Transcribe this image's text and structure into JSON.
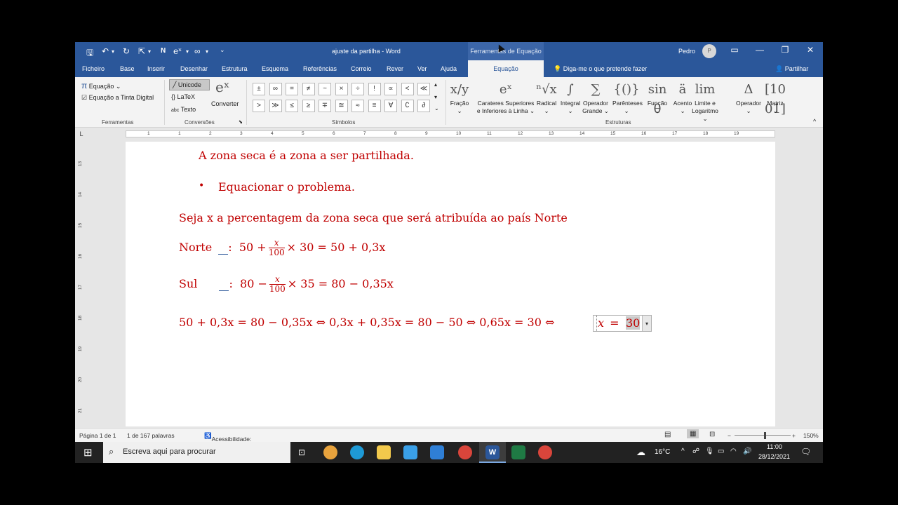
{
  "titlebar": {
    "document_title": "ajuste da partilha  -  Word",
    "context_group": "Ferramentas de Equação",
    "user_name": "Pedro",
    "user_initial": "P",
    "qat": {
      "save": "🖫",
      "undo": "↶",
      "undo_drop": "▾",
      "redo": "↻",
      "pointer": "⇱",
      "pointer_drop": "▾",
      "n": "N",
      "ex": "eˣ",
      "ex_drop": "▾",
      "inf": "∞",
      "inf_drop": "▾",
      "customize": "⌄"
    },
    "controls": {
      "ribbon_display": "▭",
      "minimize": "—",
      "restore": "❐",
      "close": "✕"
    }
  },
  "tabs": [
    "Ficheiro",
    "Base",
    "Inserir",
    "Desenhar",
    "Estrutura",
    "Esquema",
    "Referências",
    "Correio",
    "Rever",
    "Ver",
    "Ajuda"
  ],
  "active_tab": "Equação",
  "tell_me": "Diga-me o que pretende fazer",
  "share": "Partilhar",
  "ribbon": {
    "ferramentas": {
      "equation": "Equação",
      "equation_icon": "π",
      "ink": "Equação a Tinta Digital",
      "label": "Ferramentas"
    },
    "conversoes": {
      "unicode": "Unicode",
      "latex": "LaTeX",
      "text": "Texto",
      "convert": "Converter",
      "label": "Conversões",
      "dialog_launcher": "⬊"
    },
    "simbolos": {
      "row1": [
        "±",
        "∞",
        "=",
        "≠",
        "~",
        "×",
        "÷",
        "!",
        "∝",
        "<",
        "≪"
      ],
      "row2": [
        ">",
        "≫",
        "≤",
        "≥",
        "∓",
        "≅",
        "≈",
        "≡",
        "∀",
        "∁",
        "∂"
      ],
      "label": "Símbolos"
    },
    "estruturas": {
      "items": [
        {
          "icon": "x/y",
          "label1": "Fração",
          "label2": "⌄"
        },
        {
          "icon": "eˣ",
          "label1": "Carateres Superiores",
          "label2": "e Inferiores à Linha ⌄"
        },
        {
          "icon": "ⁿ√x",
          "label1": "Radical",
          "label2": "⌄"
        },
        {
          "icon": "∫",
          "label1": "Integral",
          "label2": "⌄"
        },
        {
          "icon": "∑",
          "label1": "Operador",
          "label2": "Grande ⌄"
        },
        {
          "icon": "{()}",
          "label1": "Parênteses",
          "label2": "⌄"
        },
        {
          "icon": "sin θ",
          "label1": "Função",
          "label2": "⌄"
        },
        {
          "icon": "ä",
          "label1": "Acento",
          "label2": "⌄"
        },
        {
          "icon": "lim",
          "label1": "Limite e",
          "label2": "Logaritmo ⌄"
        },
        {
          "icon": "Δ",
          "label1": "Operador",
          "label2": "⌄"
        },
        {
          "icon": "[10 01]",
          "label1": "Matriz",
          "label2": "⌄"
        }
      ],
      "label": "Estruturas",
      "collapse": "^"
    }
  },
  "ruler": {
    "ticks": [
      "1",
      "1",
      "2",
      "3",
      "4",
      "5",
      "6",
      "7",
      "8",
      "9",
      "10",
      "11",
      "12",
      "13",
      "14",
      "15",
      "16",
      "17",
      "18",
      "19"
    ],
    "vticks": [
      "13",
      "14",
      "15",
      "16",
      "17",
      "18",
      "19",
      "20",
      "21"
    ]
  },
  "document": {
    "line1": "A zona seca é a zona a ser partilhada.",
    "bullet": "•",
    "line2": "Equacionar o problema.",
    "line3": "Seja x a percentagem da zona seca que será atribuída ao país Norte",
    "norte_label": "Norte",
    "norte_sep": ":",
    "norte_a": "50 +",
    "norte_num": "x",
    "norte_den": "100",
    "norte_b": "× 30 = 50 + 0,3x",
    "sul_label": "Sul",
    "sul_sep": ":",
    "sul_a": "80 −",
    "sul_num": "x",
    "sul_den": "100",
    "sul_b": "× 35 = 80 − 0,35x",
    "chain": "50 + 0,3x = 80 − 0,35x  ⇔  0,3x + 0,35x  = 80 − 50  ⇔  0,65x  = 30 ⇔",
    "final_var": "x",
    "final_eq": " = ",
    "final_val": "30",
    "eq_dropdown": "▾"
  },
  "statusbar": {
    "page": "Página 1 de 1",
    "words": "1 de 167 palavras",
    "accessibility": "Acessibilidade: investigue",
    "zoom": "150%",
    "zoom_minus": "−",
    "zoom_plus": "+"
  },
  "taskbar": {
    "search": "Escreva aqui para procurar",
    "start_icon": "⊞",
    "search_icon": "⌕",
    "weather": "16°C",
    "weather_icon": "☁",
    "time": "11:00",
    "date": "28/12/2021",
    "tray_up": "^"
  }
}
